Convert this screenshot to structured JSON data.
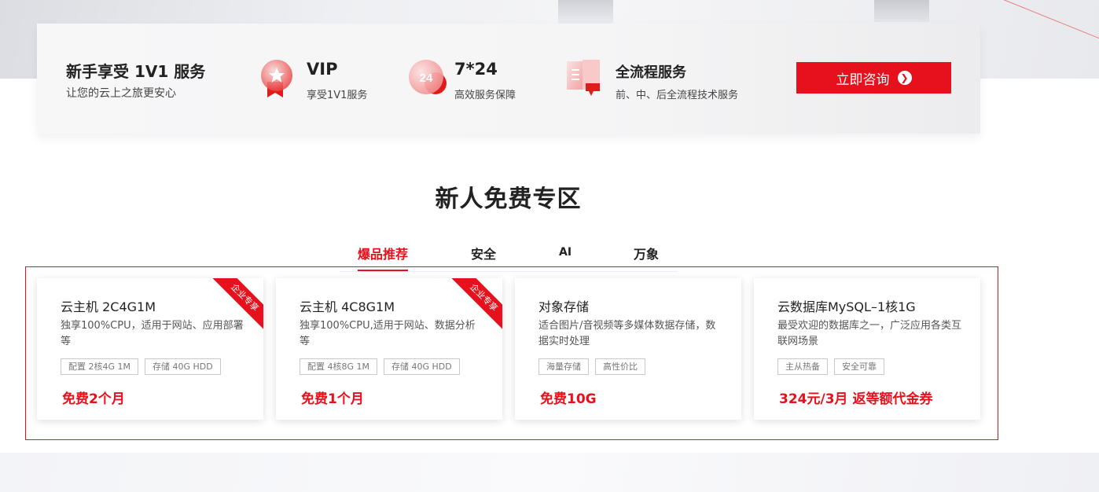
{
  "banner": {
    "intro_title": "新手享受 1V1 服务",
    "intro_sub": "让您的云上之旅更安心",
    "features": [
      {
        "title": "VIP",
        "desc": "享受1V1服务",
        "icon": "vip-badge-icon"
      },
      {
        "title": "7*24",
        "desc": "高效服务保障",
        "icon": "clock-24-icon",
        "icon_text": "24"
      },
      {
        "title": "全流程服务",
        "desc": "前、中、后全流程技术服务",
        "icon": "document-service-icon"
      }
    ],
    "consult_label": "立即咨询",
    "consult_icon": "arrow-right-circle-icon"
  },
  "section": {
    "title": "新人免费专区",
    "tabs": [
      "爆品推荐",
      "安全",
      "AI",
      "万象"
    ],
    "active_tab": 0
  },
  "cards": [
    {
      "title": "云主机 2C4G1M",
      "desc": "独享100%CPU，适用于网站、应用部署等",
      "tags": [
        "配置 2核4G 1M",
        "存储 40G HDD"
      ],
      "price": "免费2个月",
      "ribbon": "企业专享"
    },
    {
      "title": "云主机 4C8G1M",
      "desc": "独享100%CPU,适用于网站、数据分析等",
      "tags": [
        "配置 4核8G 1M",
        "存储 40G HDD"
      ],
      "price": "免费1个月",
      "ribbon": "企业专享"
    },
    {
      "title": "对象存储",
      "desc": "适合图片/音视频等多媒体数据存储，数据实时处理",
      "tags": [
        "海量存储",
        "高性价比"
      ],
      "price": "免费10G"
    },
    {
      "title": "云数据库MySQL–1核1G",
      "desc": "最受欢迎的数据库之一，广泛应用各类互联网场景",
      "tags": [
        "主从热备",
        "安全可靠"
      ],
      "price": "324元/3月 返等额代金券"
    }
  ],
  "colors": {
    "accent": "#e6111c",
    "text": "#222222",
    "muted": "#555555"
  }
}
